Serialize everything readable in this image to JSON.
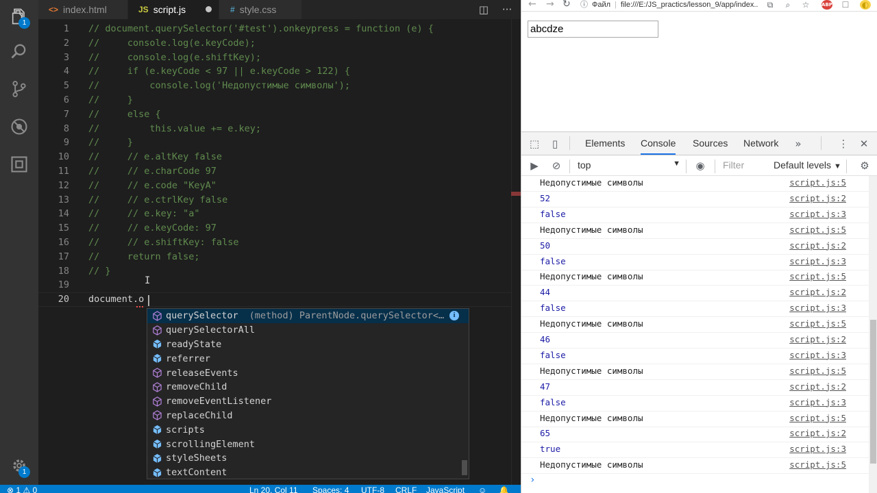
{
  "editor": {
    "tabs": [
      {
        "name": "index.html",
        "icon": "<>",
        "icon_color": "#e37933"
      },
      {
        "name": "script.js",
        "icon": "JS",
        "icon_color": "#cbcb41"
      },
      {
        "name": "style.css",
        "icon": "#",
        "icon_color": "#519aba"
      }
    ],
    "lines": [
      {
        "n": "1",
        "text": "// document.querySelector('#test').onkeypress = function (e) {"
      },
      {
        "n": "2",
        "text": "//     console.log(e.keyCode);"
      },
      {
        "n": "3",
        "text": "//     console.log(e.shiftKey);"
      },
      {
        "n": "4",
        "text": "//     if (e.keyCode < 97 || e.keyCode > 122) {"
      },
      {
        "n": "5",
        "text": "//         console.log('Недопустимые символы');"
      },
      {
        "n": "6",
        "text": "//     }"
      },
      {
        "n": "7",
        "text": "//     else {"
      },
      {
        "n": "8",
        "text": "//         this.value += e.key;"
      },
      {
        "n": "9",
        "text": "//     }"
      },
      {
        "n": "10",
        "text": "//     // e.altKey false"
      },
      {
        "n": "11",
        "text": "//     // e.charCode 97"
      },
      {
        "n": "12",
        "text": "//     // e.code \"KeyA\""
      },
      {
        "n": "13",
        "text": "//     // e.ctrlKey false"
      },
      {
        "n": "14",
        "text": "//     // e.key: \"a\""
      },
      {
        "n": "15",
        "text": "//     // e.keyCode: 97"
      },
      {
        "n": "16",
        "text": "//     // e.shiftKey: false"
      },
      {
        "n": "17",
        "text": "//     return false;"
      },
      {
        "n": "18",
        "text": "// }"
      },
      {
        "n": "19",
        "text": ""
      },
      {
        "n": "20",
        "text": "document.o"
      }
    ],
    "suggestions": [
      {
        "prefix": "",
        "rest": "querySelector",
        "kind": "method",
        "detail": "(method) ParentNode.querySelector<K ext..."
      },
      {
        "prefix": "",
        "rest": "querySelectorAll",
        "kind": "method"
      },
      {
        "prefix": "",
        "rest": "readyState",
        "kind": "property"
      },
      {
        "prefix": "",
        "rest": "referrer",
        "kind": "property"
      },
      {
        "prefix": "",
        "rest": "releaseEvents",
        "kind": "method"
      },
      {
        "prefix": "",
        "rest": "removeChild",
        "kind": "method"
      },
      {
        "prefix": "",
        "rest": "removeEventListener",
        "kind": "method"
      },
      {
        "prefix": "",
        "rest": "replaceChild",
        "kind": "method"
      },
      {
        "prefix": "",
        "rest": "scripts",
        "kind": "property"
      },
      {
        "prefix": "",
        "rest": "scrollingElement",
        "kind": "property"
      },
      {
        "prefix": "",
        "rest": "styleSheets",
        "kind": "property"
      },
      {
        "prefix": "",
        "rest": "textContent",
        "kind": "property"
      }
    ],
    "activity_badges": {
      "explorer": "1",
      "settings": "1"
    }
  },
  "status": {
    "errors": "1",
    "warnings": "0",
    "position": "Ln 20, Col 11",
    "spaces": "Spaces: 4",
    "encoding": "UTF-8",
    "eol": "CRLF",
    "language": "JavaScript"
  },
  "browser": {
    "protocol_label": "Файл",
    "url": "file:///E:/JS_practics/lesson_9/app/index...",
    "input_value": "abcdze",
    "devtools_tabs": [
      "Elements",
      "Console",
      "Sources",
      "Network"
    ],
    "active_tab": "Console",
    "context": "top",
    "filter_placeholder": "Filter",
    "levels": "Default levels",
    "messages": [
      {
        "text": "Недопустимые символы",
        "src": "script.js:5",
        "type": "str"
      },
      {
        "text": "52",
        "src": "script.js:2",
        "type": "num"
      },
      {
        "text": "false",
        "src": "script.js:3",
        "type": "bool"
      },
      {
        "text": "Недопустимые символы",
        "src": "script.js:5",
        "type": "str"
      },
      {
        "text": "50",
        "src": "script.js:2",
        "type": "num"
      },
      {
        "text": "false",
        "src": "script.js:3",
        "type": "bool"
      },
      {
        "text": "Недопустимые символы",
        "src": "script.js:5",
        "type": "str"
      },
      {
        "text": "44",
        "src": "script.js:2",
        "type": "num"
      },
      {
        "text": "false",
        "src": "script.js:3",
        "type": "bool"
      },
      {
        "text": "Недопустимые символы",
        "src": "script.js:5",
        "type": "str"
      },
      {
        "text": "46",
        "src": "script.js:2",
        "type": "num"
      },
      {
        "text": "false",
        "src": "script.js:3",
        "type": "bool"
      },
      {
        "text": "Недопустимые символы",
        "src": "script.js:5",
        "type": "str"
      },
      {
        "text": "47",
        "src": "script.js:2",
        "type": "num"
      },
      {
        "text": "false",
        "src": "script.js:3",
        "type": "bool"
      },
      {
        "text": "Недопустимые символы",
        "src": "script.js:5",
        "type": "str"
      },
      {
        "text": "65",
        "src": "script.js:2",
        "type": "num"
      },
      {
        "text": "true",
        "src": "script.js:3",
        "type": "bool"
      },
      {
        "text": "Недопустимые символы",
        "src": "script.js:5",
        "type": "str"
      }
    ],
    "prompt": "›"
  },
  "colors": {
    "accent": "#007acc",
    "comment": "#608b4e",
    "devtools_active": "#1a73e8"
  }
}
